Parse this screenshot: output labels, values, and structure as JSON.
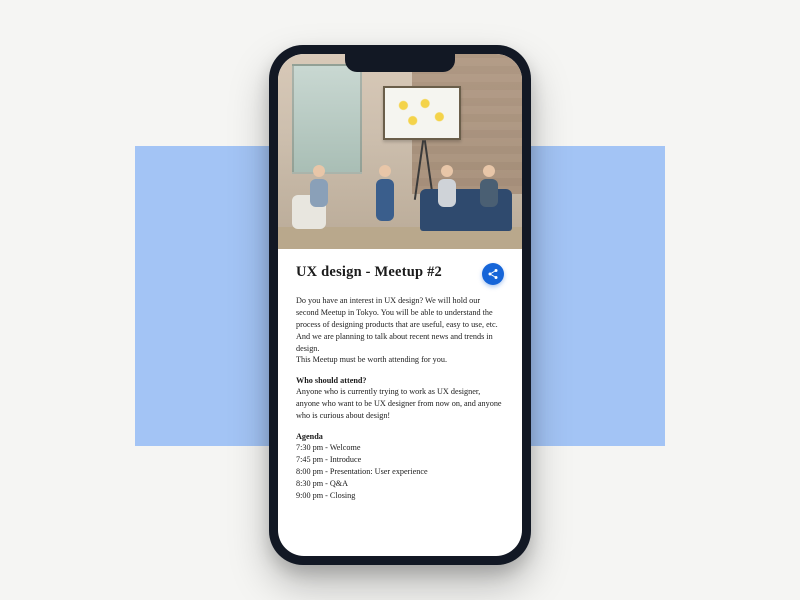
{
  "colors": {
    "background": "#f5f5f3",
    "accent_rect": "#a3c4f5",
    "phone_frame": "#121824",
    "share_button": "#1665d8"
  },
  "event": {
    "title": "UX design - Meetup #2",
    "description": "Do you have an interest in UX design? We will hold our second Meetup in Tokyo. You will be able to understand the process of designing products that are useful, easy to use, etc. And we are planning to talk about recent news and trends in design.\nThis Meetup must be worth attending for you.",
    "who_label": "Who should attend?",
    "who_body": "Anyone who is currently trying to work as UX designer, anyone who want to be UX designer from now on, and anyone who is curious about design!",
    "agenda_label": "Agenda",
    "agenda": [
      "7:30 pm - Welcome",
      "7:45 pm - Introduce",
      "8:00 pm - Presentation: User experience",
      "8:30 pm - Q&A",
      "9:00 pm - Closing"
    ]
  },
  "icons": {
    "share": "share-icon"
  }
}
